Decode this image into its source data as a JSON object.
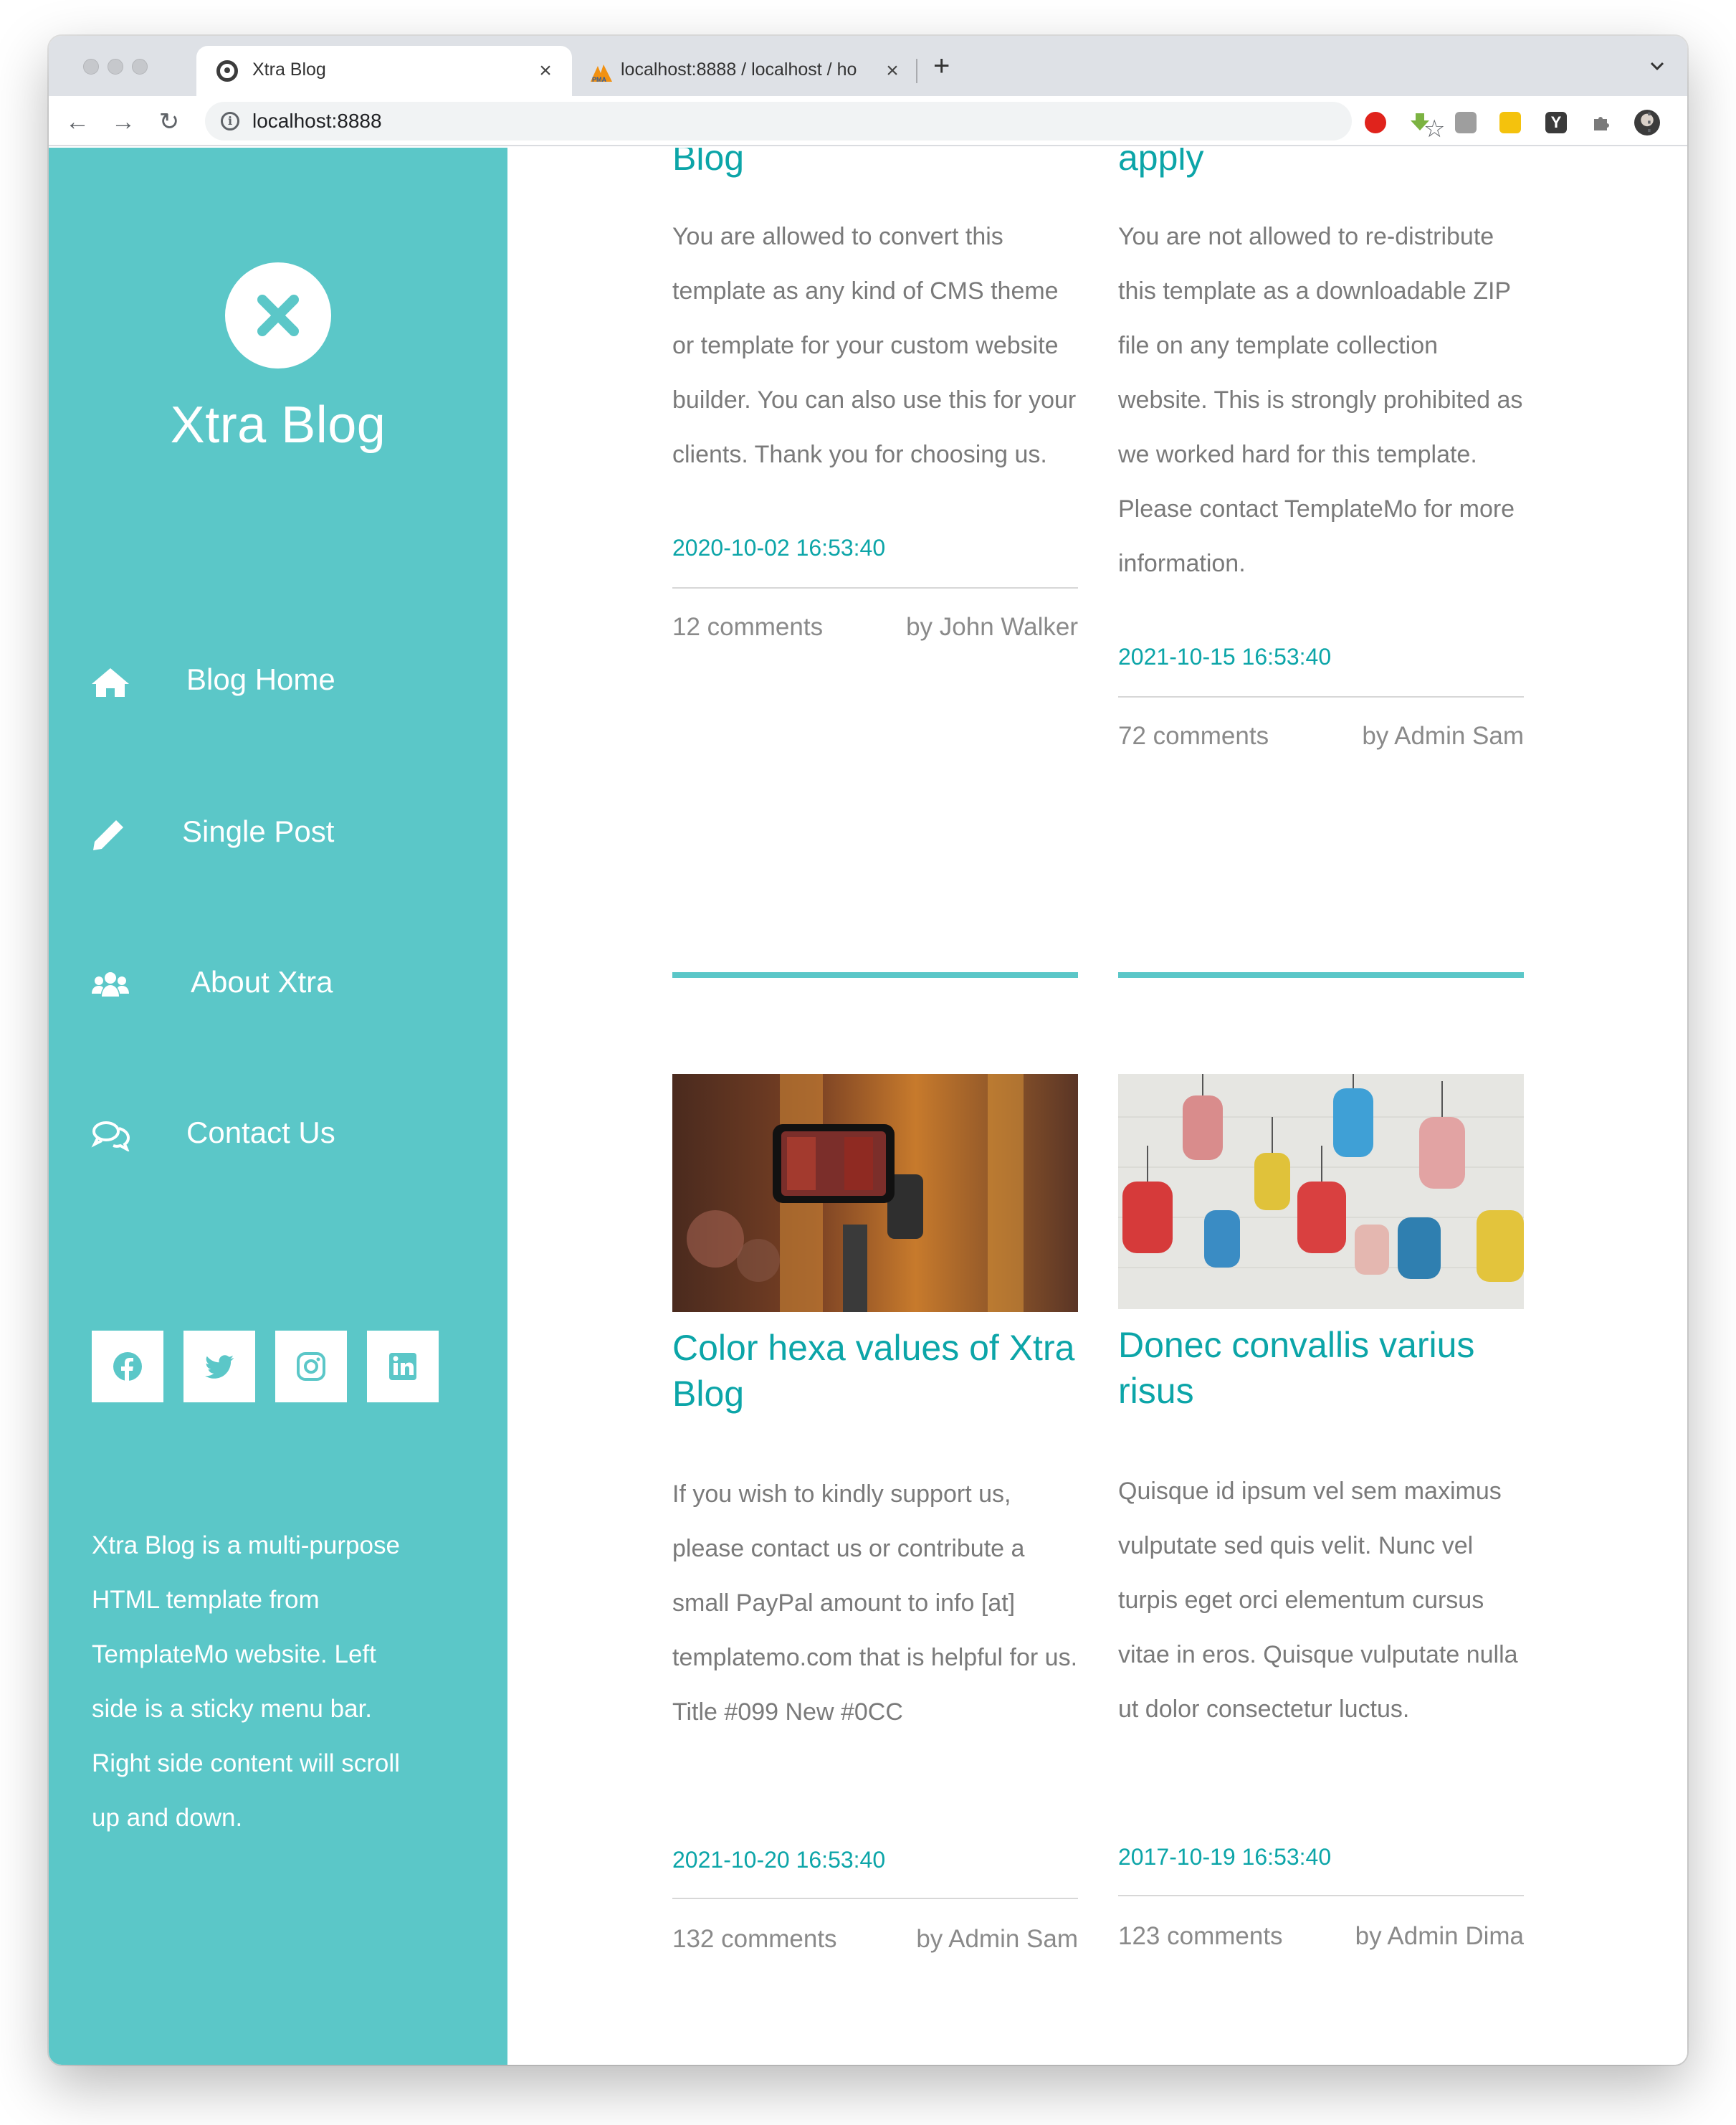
{
  "browser": {
    "active_tab_title": "Xtra Blog",
    "inactive_tab_title": "localhost:8888 / localhost / ho",
    "url": "localhost:8888",
    "close_glyph": "×",
    "new_tab_glyph": "+"
  },
  "sidebar": {
    "site_title": "Xtra Blog",
    "nav": [
      {
        "label": "Blog Home",
        "icon": "home-icon"
      },
      {
        "label": "Single Post",
        "icon": "pencil-icon"
      },
      {
        "label": "About Xtra",
        "icon": "users-icon"
      },
      {
        "label": "Contact Us",
        "icon": "comments-icon"
      }
    ],
    "social": [
      "facebook-icon",
      "twitter-icon",
      "instagram-icon",
      "linkedin-icon"
    ],
    "about": "Xtra Blog is a multi-purpose HTML template from TemplateMo website. Left side is a sticky menu bar. Right side content will scroll up and down."
  },
  "posts": {
    "top_left": {
      "title_tail": "Blog",
      "body": "You are allowed to convert this template as any kind of CMS theme or template for your custom website builder. You can also use this for your clients. Thank you for choosing us.",
      "date": "2020-10-02 16:53:40",
      "comments": "12 comments",
      "author": "by John Walker"
    },
    "top_right": {
      "title_tail": "apply",
      "body": "You are not allowed to re-distribute this template as a downloadable ZIP file on any template collection website. This is strongly prohibited as we worked hard for this template. Please contact TemplateMo for more information.",
      "date": "2021-10-15 16:53:40",
      "comments": "72 comments",
      "author": "by Admin Sam"
    },
    "bottom_left": {
      "title": "Color hexa values of Xtra Blog",
      "body": "If you wish to kindly support us, please contact us or contribute a small PayPal amount to info [at] templatemo.com that is helpful for us. Title #099 New #0CC",
      "date": "2021-10-20 16:53:40",
      "comments": "132 comments",
      "author": "by Admin Sam"
    },
    "bottom_right": {
      "title": "Donec convallis varius risus",
      "body": "Quisque id ipsum vel sem maximus vulputate sed quis velit. Nunc vel turpis eget orci elementum cursus vitae in eros. Quisque vulputate nulla ut dolor consectetur luctus.",
      "date": "2017-10-19 16:53:40",
      "comments": "123 comments",
      "author": "by Admin Dima"
    }
  },
  "colors": {
    "sidebar": "#5bc7c8",
    "accent_text": "#0ca5a8",
    "body_text": "#7a7a7a"
  }
}
